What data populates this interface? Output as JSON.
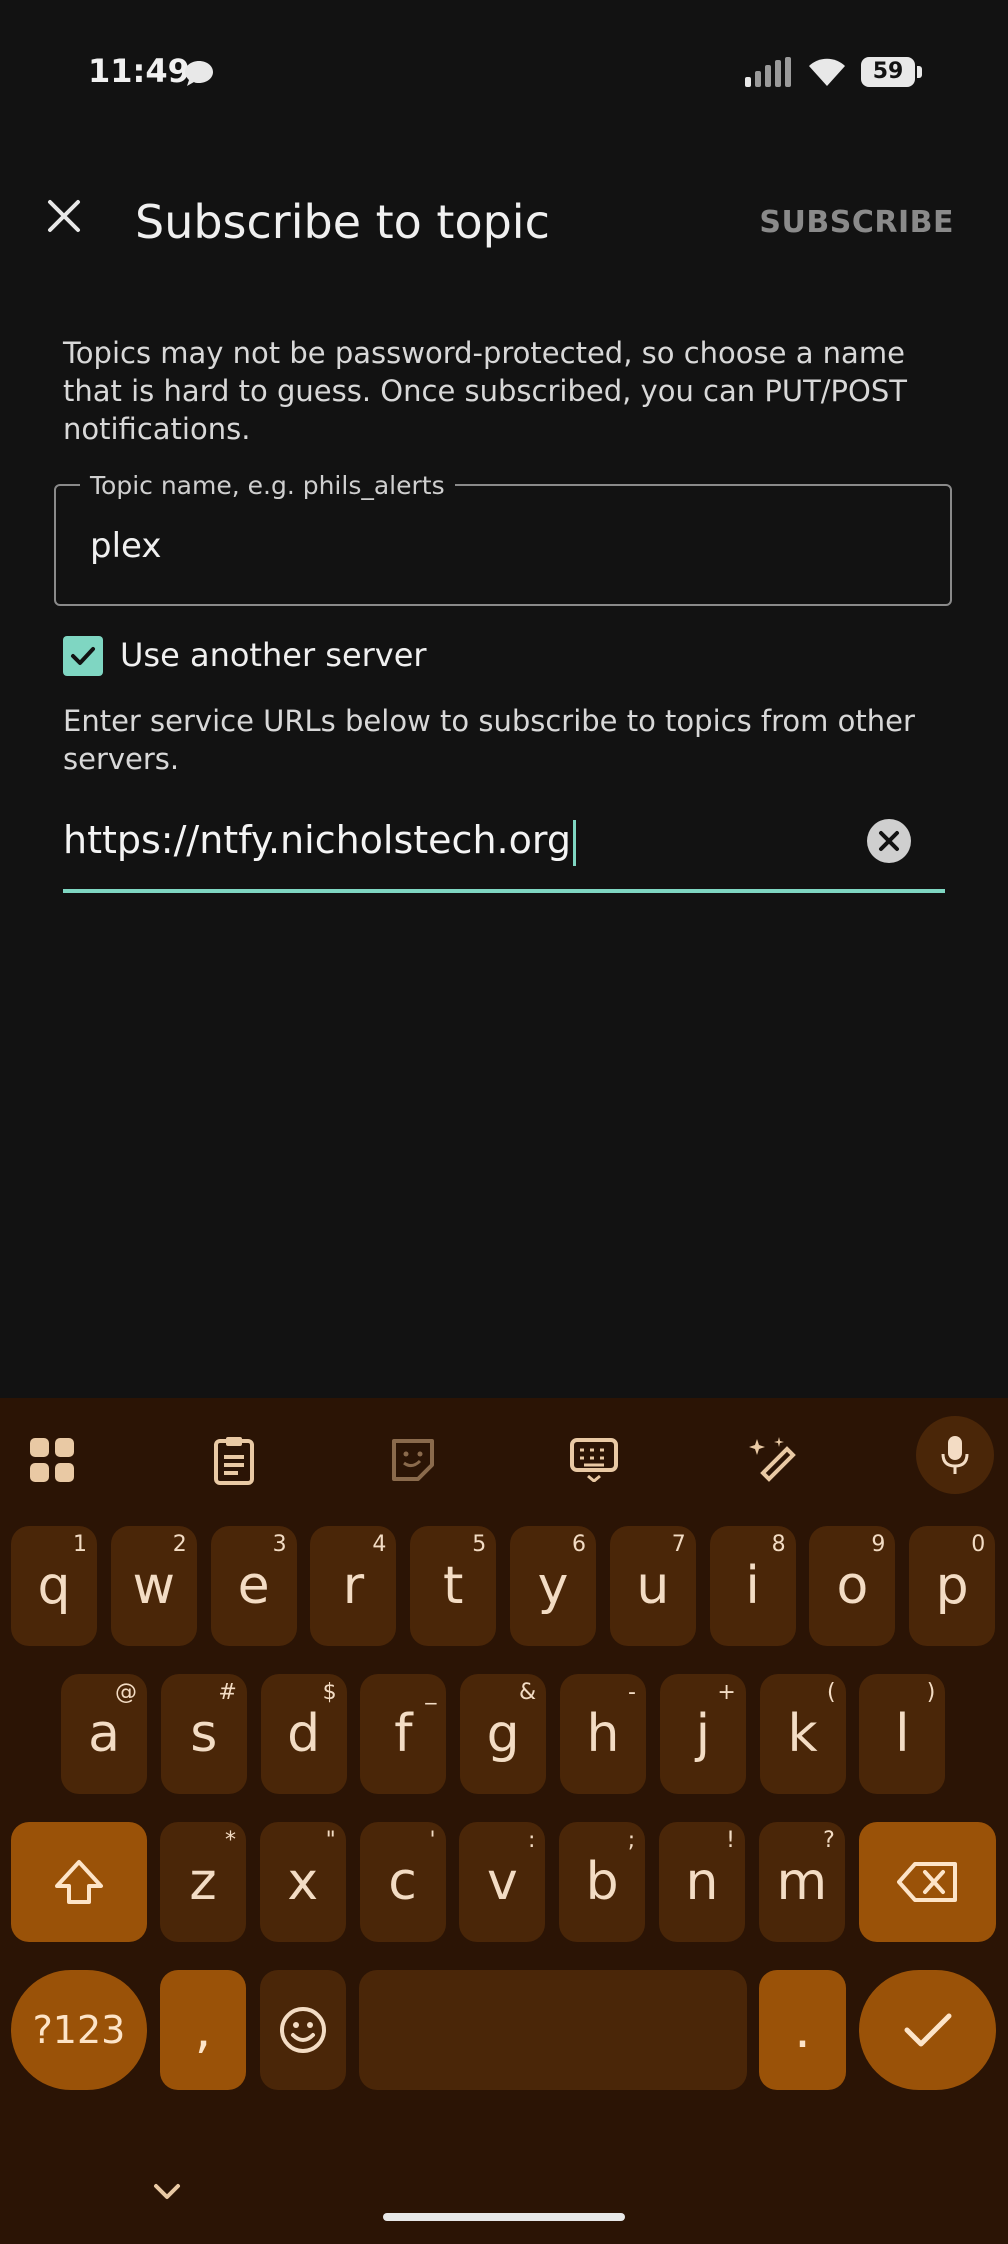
{
  "status": {
    "time": "11:49",
    "battery": "59"
  },
  "appbar": {
    "title": "Subscribe to topic",
    "subscribe_label": "SUBSCRIBE"
  },
  "form": {
    "description": "Topics may not be password-protected, so choose a name that is hard to guess. Once subscribed, you can PUT/POST notifications.",
    "topic_label": "Topic name, e.g. phils_alerts",
    "topic_value": "plex",
    "use_another_server_label": "Use another server",
    "use_another_server_checked": true,
    "server_hint": "Enter service URLs below to subscribe to topics from other servers.",
    "server_url": "https://ntfy.nicholstech.org"
  },
  "keyboard": {
    "row1": [
      {
        "key": "q",
        "alt": "1"
      },
      {
        "key": "w",
        "alt": "2"
      },
      {
        "key": "e",
        "alt": "3"
      },
      {
        "key": "r",
        "alt": "4"
      },
      {
        "key": "t",
        "alt": "5"
      },
      {
        "key": "y",
        "alt": "6"
      },
      {
        "key": "u",
        "alt": "7"
      },
      {
        "key": "i",
        "alt": "8"
      },
      {
        "key": "o",
        "alt": "9"
      },
      {
        "key": "p",
        "alt": "0"
      }
    ],
    "row2": [
      {
        "key": "a",
        "alt": "@"
      },
      {
        "key": "s",
        "alt": "#"
      },
      {
        "key": "d",
        "alt": "$"
      },
      {
        "key": "f",
        "alt": "_"
      },
      {
        "key": "g",
        "alt": "&"
      },
      {
        "key": "h",
        "alt": "-"
      },
      {
        "key": "j",
        "alt": "+"
      },
      {
        "key": "k",
        "alt": "("
      },
      {
        "key": "l",
        "alt": ")"
      }
    ],
    "row3": [
      {
        "key": "z",
        "alt": "*"
      },
      {
        "key": "x",
        "alt": "\""
      },
      {
        "key": "c",
        "alt": "'"
      },
      {
        "key": "v",
        "alt": ":"
      },
      {
        "key": "b",
        "alt": ";"
      },
      {
        "key": "n",
        "alt": "!"
      },
      {
        "key": "m",
        "alt": "?"
      }
    ],
    "symbols_label": "?123",
    "comma_label": ",",
    "period_label": ".",
    "accent_color": "#9a5208",
    "key_color": "#4a2608",
    "background_color": "#2b1405"
  },
  "colors": {
    "accent": "#7fd6c2",
    "background": "#121212"
  }
}
